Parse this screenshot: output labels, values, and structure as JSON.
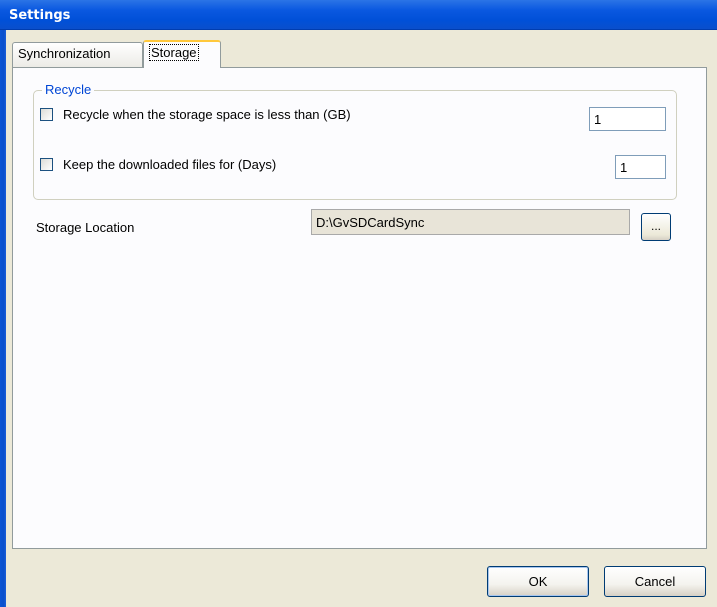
{
  "window": {
    "title": "Settings"
  },
  "tabs": [
    {
      "label": "Synchronization",
      "active": false
    },
    {
      "label": "Storage",
      "active": true
    }
  ],
  "recycle_group": {
    "label": "Recycle",
    "recycle_option": {
      "label": "Recycle when the storage space is less than (GB)",
      "checked": false,
      "value": "1"
    },
    "keep_option": {
      "label": "Keep the downloaded files for (Days)",
      "checked": false,
      "value": "1"
    }
  },
  "storage_location": {
    "label": "Storage Location",
    "value": "D:\\GvSDCardSync",
    "browse_label": "..."
  },
  "footer": {
    "ok_label": "OK",
    "cancel_label": "Cancel"
  },
  "colors": {
    "titlebar": "#0050d8",
    "group_label": "#0046d5",
    "active_tab_highlight": "#ffc83c"
  }
}
